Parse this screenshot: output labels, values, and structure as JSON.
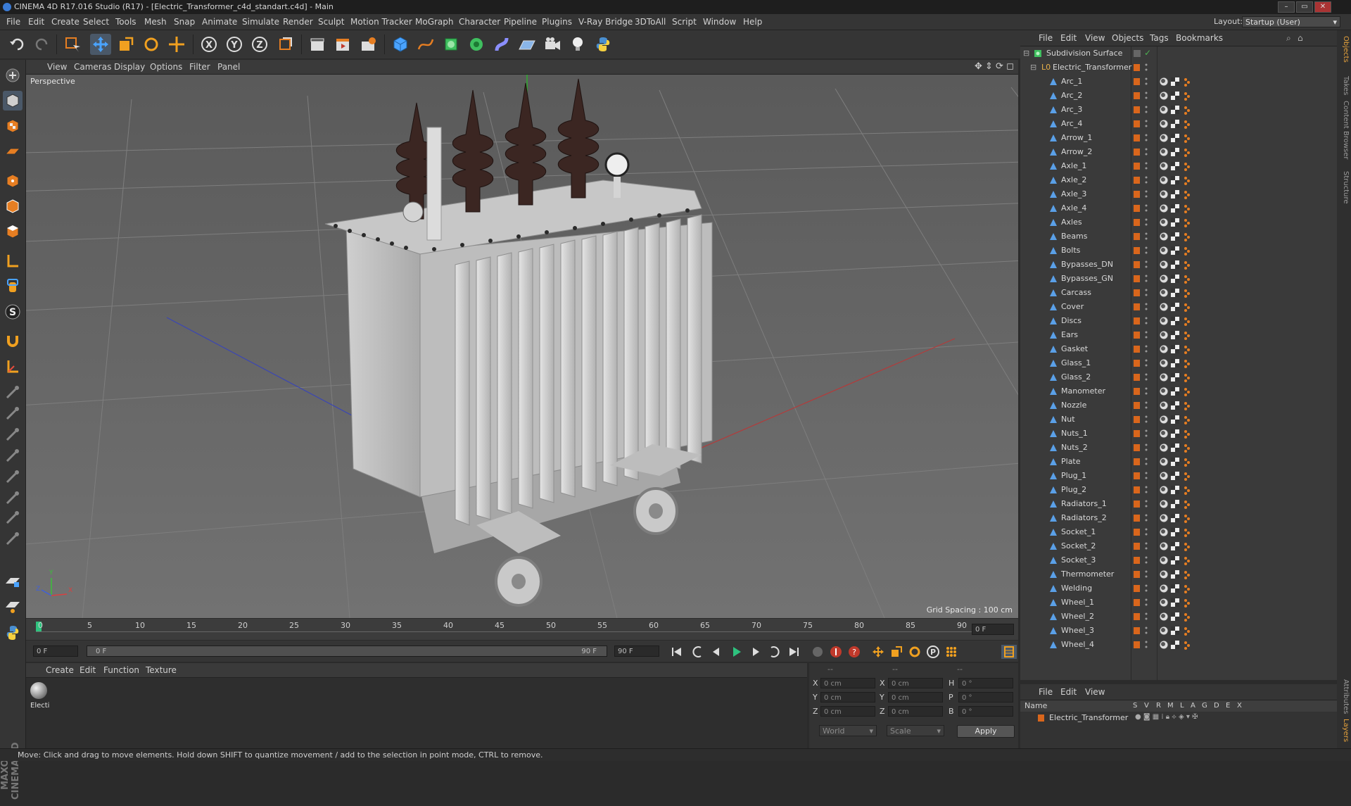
{
  "window": {
    "title": "CINEMA 4D R17.016 Studio (R17) - [Electric_Transformer_c4d_standart.c4d] - Main",
    "controls": [
      "–",
      "▭",
      "✕"
    ]
  },
  "menubar": {
    "items": [
      "File",
      "Edit",
      "Create",
      "Select",
      "Tools",
      "Mesh",
      "Snap",
      "Animate",
      "Simulate",
      "Render",
      "Sculpt",
      "Motion Tracker",
      "MoGraph",
      "Character",
      "Pipeline",
      "Plugins",
      "V-Ray Bridge",
      "3DToAll",
      "Script",
      "Window",
      "Help"
    ],
    "layout_label": "Layout:",
    "layout_value": "Startup (User)"
  },
  "viewport": {
    "menu": [
      "View",
      "Cameras",
      "Display",
      "Options",
      "Filter",
      "Panel"
    ],
    "label": "Perspective",
    "grid_spacing": "Grid Spacing : 100 cm",
    "axis_y": "Y",
    "axis_x": "X",
    "axis_z": "Z"
  },
  "timeline": {
    "ticks": [
      "0",
      "5",
      "10",
      "15",
      "20",
      "25",
      "30",
      "35",
      "40",
      "45",
      "50",
      "55",
      "60",
      "65",
      "70",
      "75",
      "80",
      "85",
      "90"
    ],
    "current_frame": "0 F",
    "start_field": "0 F",
    "range_start": "0 F",
    "range_end": "90 F",
    "end_field": "90 F"
  },
  "material_manager": {
    "menu": [
      "Create",
      "Edit",
      "Function",
      "Texture"
    ],
    "materials": [
      {
        "name": "Electi"
      }
    ]
  },
  "coordinates": {
    "header": [
      "--",
      "--",
      "--"
    ],
    "rows": [
      {
        "a_label": "X",
        "a_val": "0 cm",
        "b_label": "X",
        "b_val": "0 cm",
        "c_label": "H",
        "c_val": "0 °"
      },
      {
        "a_label": "Y",
        "a_val": "0 cm",
        "b_label": "Y",
        "b_val": "0 cm",
        "c_label": "P",
        "c_val": "0 °"
      },
      {
        "a_label": "Z",
        "a_val": "0 cm",
        "b_label": "Z",
        "b_val": "0 cm",
        "c_label": "B",
        "c_val": "0 °"
      }
    ],
    "mode": "World",
    "type": "Scale",
    "apply": "Apply"
  },
  "status_bar": "Move: Click and drag to move elements. Hold down SHIFT to quantize movement / add to the selection in point mode, CTRL to remove.",
  "object_manager": {
    "menu": [
      "File",
      "Edit",
      "View",
      "Objects",
      "Tags",
      "Bookmarks"
    ],
    "root": "Subdivision Surface",
    "group": "Electric_Transformer",
    "objects": [
      "Arc_1",
      "Arc_2",
      "Arc_3",
      "Arc_4",
      "Arrow_1",
      "Arrow_2",
      "Axle_1",
      "Axle_2",
      "Axle_3",
      "Axle_4",
      "Axles",
      "Beams",
      "Bolts",
      "Bypasses_DN",
      "Bypasses_GN",
      "Carcass",
      "Cover",
      "Discs",
      "Ears",
      "Gasket",
      "Glass_1",
      "Glass_2",
      "Manometer",
      "Nozzle",
      "Nut",
      "Nuts_1",
      "Nuts_2",
      "Plate",
      "Plug_1",
      "Plug_2",
      "Radiators_1",
      "Radiators_2",
      "Socket_1",
      "Socket_2",
      "Socket_3",
      "Thermometer",
      "Welding",
      "Wheel_1",
      "Wheel_2",
      "Wheel_3",
      "Wheel_4"
    ]
  },
  "right_tabs": [
    "Objects",
    "Takes",
    "Content Browser",
    "Structure",
    "Attributes",
    "Layers"
  ],
  "layer_manager": {
    "menu": [
      "File",
      "Edit",
      "View"
    ],
    "columns": [
      "Name",
      "S",
      "V",
      "R",
      "M",
      "L",
      "A",
      "G",
      "D",
      "E",
      "X"
    ],
    "layers": [
      {
        "name": "Electric_Transformer"
      }
    ]
  },
  "branding": "MAXON CINEMA 4D",
  "colors": {
    "accent_orange": "#d9661c",
    "layer_orange": "#d9661c",
    "check_green": "#4caf50"
  }
}
